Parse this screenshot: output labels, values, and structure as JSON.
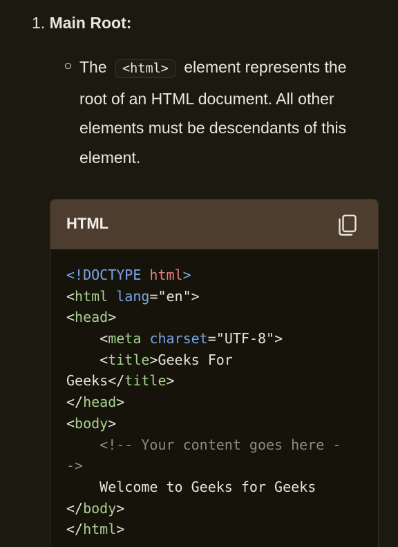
{
  "list": {
    "number": "1.",
    "title": "Main Root:"
  },
  "bullet": {
    "text_before": "The",
    "code": "<html>",
    "text_after": "element represents the root of an HTML document. All other elements must be descendants of this element."
  },
  "code_block": {
    "language": "HTML",
    "copy_icon": "copy-icon",
    "lines": [
      [
        {
          "t": "<!DOCTYPE ",
          "c": "kw"
        },
        {
          "t": "html",
          "c": "red"
        },
        {
          "t": ">",
          "c": "kw"
        }
      ],
      [
        {
          "t": "<",
          "c": "plain"
        },
        {
          "t": "html",
          "c": "tag"
        },
        {
          "t": " ",
          "c": "plain"
        },
        {
          "t": "lang",
          "c": "attr"
        },
        {
          "t": "=\"en\">",
          "c": "plain"
        }
      ],
      [
        {
          "t": "<",
          "c": "plain"
        },
        {
          "t": "head",
          "c": "tag"
        },
        {
          "t": ">",
          "c": "plain"
        }
      ],
      [
        {
          "t": "    <",
          "c": "plain"
        },
        {
          "t": "meta",
          "c": "tag"
        },
        {
          "t": " ",
          "c": "plain"
        },
        {
          "t": "charset",
          "c": "attr"
        },
        {
          "t": "=\"UTF-8\">",
          "c": "plain"
        }
      ],
      [
        {
          "t": "    <",
          "c": "plain"
        },
        {
          "t": "title",
          "c": "tag"
        },
        {
          "t": ">Geeks For",
          "c": "plain"
        }
      ],
      [
        {
          "t": "Geeks</",
          "c": "plain"
        },
        {
          "t": "title",
          "c": "tag"
        },
        {
          "t": ">",
          "c": "plain"
        }
      ],
      [
        {
          "t": "</",
          "c": "plain"
        },
        {
          "t": "head",
          "c": "tag"
        },
        {
          "t": ">",
          "c": "plain"
        }
      ],
      [
        {
          "t": "<",
          "c": "plain"
        },
        {
          "t": "body",
          "c": "tag"
        },
        {
          "t": ">",
          "c": "plain"
        }
      ],
      [
        {
          "t": "    <!-- Your content goes here -",
          "c": "comment"
        }
      ],
      [
        {
          "t": "->",
          "c": "comment"
        }
      ],
      [
        {
          "t": "    Welcome to Geeks for Geeks",
          "c": "plain"
        }
      ],
      [
        {
          "t": "</",
          "c": "plain"
        },
        {
          "t": "body",
          "c": "tag"
        },
        {
          "t": ">",
          "c": "plain"
        }
      ],
      [
        {
          "t": "</",
          "c": "plain"
        },
        {
          "t": "html",
          "c": "tag"
        },
        {
          "t": ">",
          "c": "plain"
        }
      ]
    ]
  },
  "colors": {
    "background": "#1c1a10",
    "code_header": "#4d3d2e",
    "keyword": "#7aa5e6",
    "tag": "#a6d28e",
    "doctype_html": "#e57f7a",
    "comment": "#8d8a80"
  }
}
